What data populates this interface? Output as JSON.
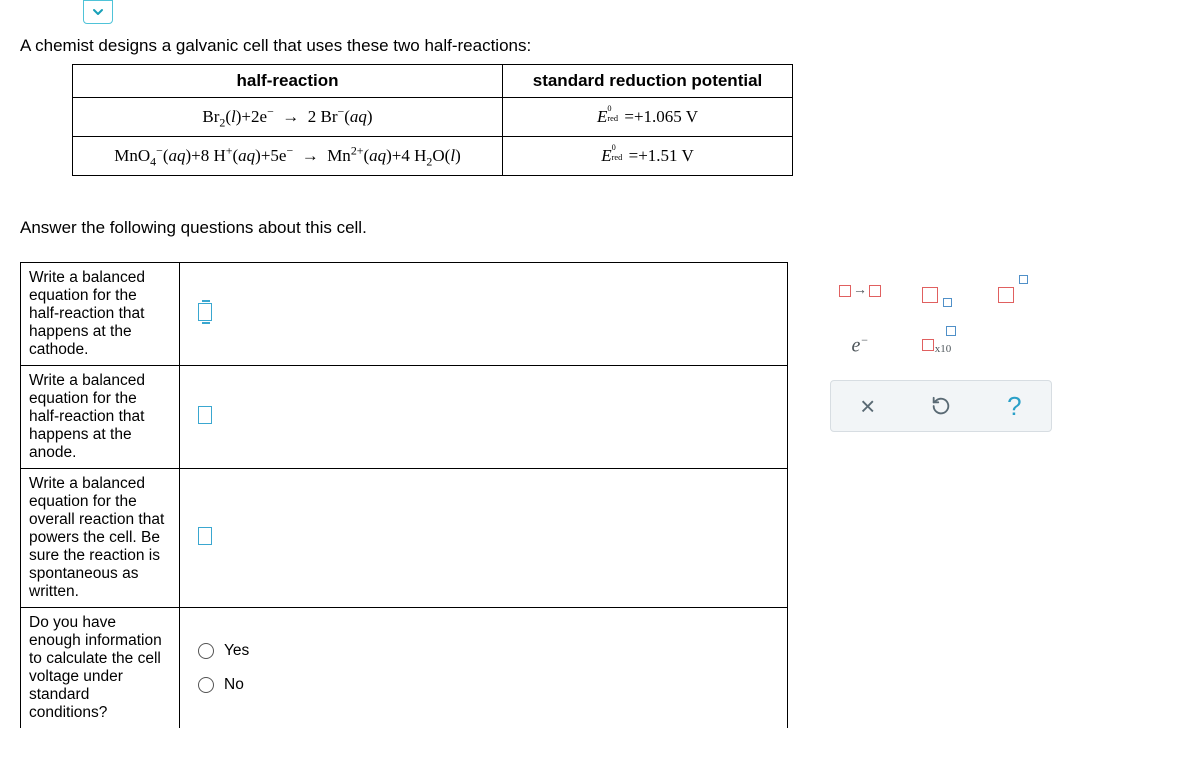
{
  "chevron": "expanded",
  "intro_text": "A chemist designs a galvanic cell that uses these two half-reactions:",
  "table_headers": {
    "half_reaction": "half-reaction",
    "potential": "standard reduction potential"
  },
  "reactions": [
    {
      "equation_html": "Br<sub>2</sub>(<i>l</i>)+2e<sup>−</sup>&nbsp;&nbsp;→&nbsp;&nbsp;2 Br<sup>−</sup>(<i>aq</i>)",
      "potential_html": "<i>E</i><span style='font-size:0.7em;position:relative;'><sup style='position:absolute;left:0;top:-0.9em;'>0</sup><sub style='position:absolute;left:0;top:0.3em;'>red</sub></span>&nbsp;&nbsp;&nbsp;&nbsp;=+1.065 V"
    },
    {
      "equation_html": "MnO<sub>4</sub><sup>−</sup>(<i>aq</i>)+8 H<sup>+</sup>(<i>aq</i>)+5e<sup>−</sup>&nbsp;&nbsp;→&nbsp;&nbsp;Mn<sup>2+</sup>(<i>aq</i>)+4 H<sub>2</sub>O(<i>l</i>)",
      "potential_html": "<i>E</i><span style='font-size:0.7em;position:relative;'><sup style='position:absolute;left:0;top:-0.9em;'>0</sup><sub style='position:absolute;left:0;top:0.3em;'>red</sub></span>&nbsp;&nbsp;&nbsp;&nbsp;=+1.51 V"
    }
  ],
  "answer_following": "Answer the following questions about this cell.",
  "prompts": {
    "cathode": "Write a balanced equation for the half-reaction that happens at the cathode.",
    "anode": "Write a balanced equation for the half-reaction that happens at the anode.",
    "overall": "Write a balanced equation for the overall reaction that powers the cell. Be sure the reaction is spontaneous as written.",
    "voltage": "Do you have enough information to calculate the cell voltage under standard conditions?"
  },
  "radio": {
    "yes": "Yes",
    "no": "No"
  },
  "palette": {
    "arrow": "→",
    "electron": "e",
    "x10": "x10"
  },
  "controls": {
    "close": "×",
    "reset": "↺",
    "help": "?"
  }
}
